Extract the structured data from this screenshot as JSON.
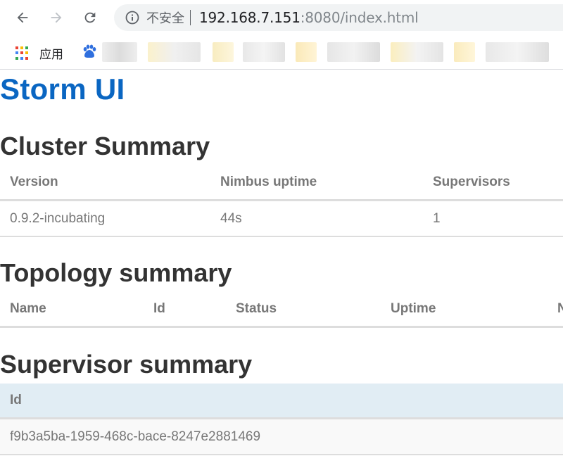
{
  "browser": {
    "security_label": "不安全",
    "url_host": "192.168.7.151",
    "url_rest": ":8080/index.html",
    "bookmarks": {
      "apps_label": "应用"
    }
  },
  "page": {
    "title": "Storm UI",
    "cluster": {
      "heading": "Cluster Summary",
      "columns": [
        "Version",
        "Nimbus uptime",
        "Supervisors"
      ],
      "row": [
        "0.9.2-incubating",
        "44s",
        "1"
      ]
    },
    "topology": {
      "heading": "Topology summary",
      "columns": [
        "Name",
        "Id",
        "Status",
        "Uptime",
        "N"
      ]
    },
    "supervisor": {
      "heading": "Supervisor summary",
      "columns": [
        "Id"
      ],
      "row": [
        "f9b3a5ba-1959-468c-bace-8247e2881469"
      ]
    }
  },
  "colors": {
    "brand": "#0a66c2",
    "heading": "#333333",
    "cell_text": "#777777",
    "header_highlight": "#e1edf4"
  }
}
